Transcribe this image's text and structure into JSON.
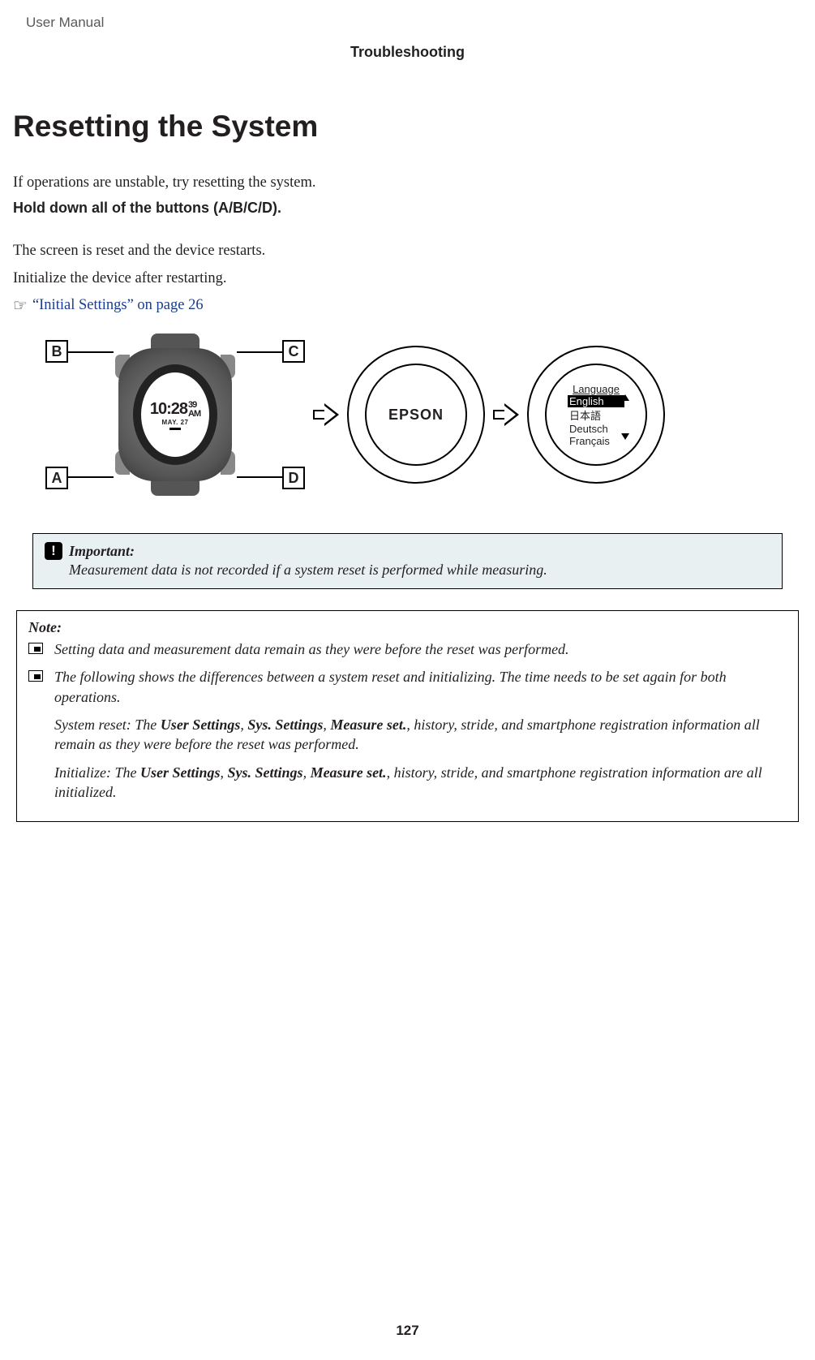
{
  "header": {
    "doc_title": "User Manual",
    "section": "Troubleshooting"
  },
  "page": {
    "heading": "Resetting the System",
    "p1": "If operations are unstable, try resetting the system.",
    "instr": "Hold down all of the buttons (A/B/C/D).",
    "p2": "The screen is reset and the device restarts.",
    "p3": "Initialize the device after restarting.",
    "xref": "“Initial Settings” on page 26"
  },
  "watch": {
    "btn_a": "A",
    "btn_b": "B",
    "btn_c": "C",
    "btn_d": "D",
    "time_hm": "10:28",
    "time_sec": "39",
    "time_ampm": "AM",
    "date": "MAY. 27"
  },
  "screens": {
    "logo": "EPSON",
    "lang_title": "Language",
    "lang_opts": [
      "English",
      "日本語",
      "Deutsch",
      "Français"
    ]
  },
  "important": {
    "title": "Important:",
    "body": "Measurement data is not recorded if a system reset is performed while measuring."
  },
  "note": {
    "title": "Note:",
    "item1": "Setting data and measurement data remain as they were before the reset was performed.",
    "item2_intro": "The following shows the differences between a system reset and initializing. The time needs to be set again for both operations.",
    "sr_prefix": "System reset: The ",
    "sr_b1": "User Settings",
    "sr_c1": ", ",
    "sr_b2": "Sys. Settings",
    "sr_c2": ", ",
    "sr_b3": "Measure set.",
    "sr_tail": ", history, stride, and smartphone registration information all remain as they were before the reset was performed.",
    "in_prefix": "Initialize: The ",
    "in_b1": "User Settings",
    "in_c1": ", ",
    "in_b2": "Sys. Settings",
    "in_c2": ", ",
    "in_b3": "Measure set.",
    "in_tail": ", history, stride, and smartphone registration information are all initialized."
  },
  "page_number": "127"
}
